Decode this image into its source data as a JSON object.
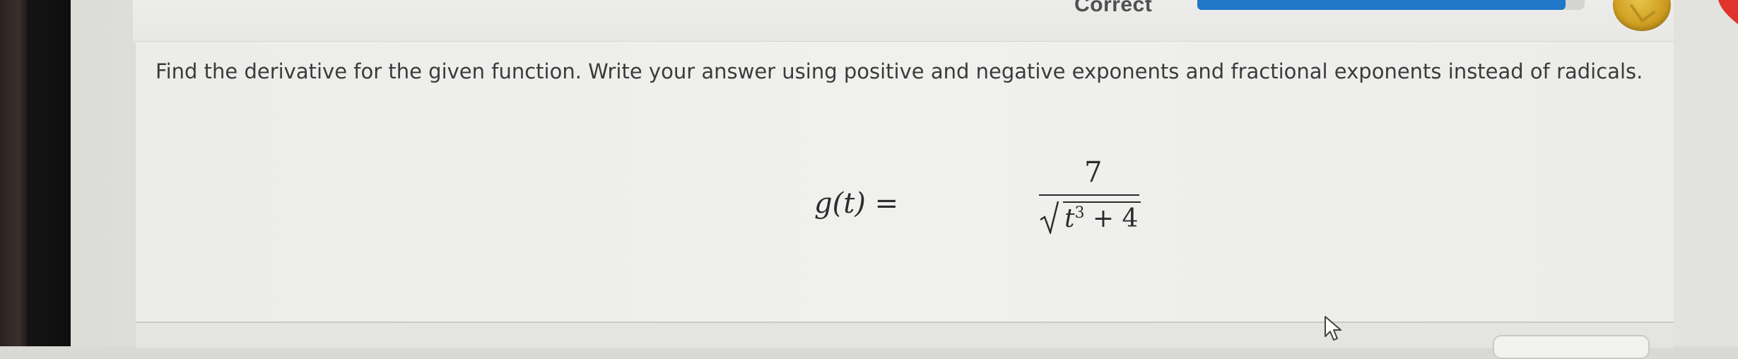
{
  "header": {
    "status": "Correct",
    "progress_fraction": 0.95,
    "accent_color": "#1f77c9",
    "coin_icon": "coin-icon",
    "lives_icon": "heart-icon"
  },
  "question": {
    "prompt": "Find the derivative for the given function. Write your answer using positive and negative exponents and fractional exponents instead of radicals.",
    "equation": {
      "lhs": "g(t) =",
      "numerator": "7",
      "radicand_base": "t",
      "radicand_exponent": "3",
      "radicand_rest": "+ 4"
    }
  },
  "footer": {
    "button_icon": "next-button"
  }
}
